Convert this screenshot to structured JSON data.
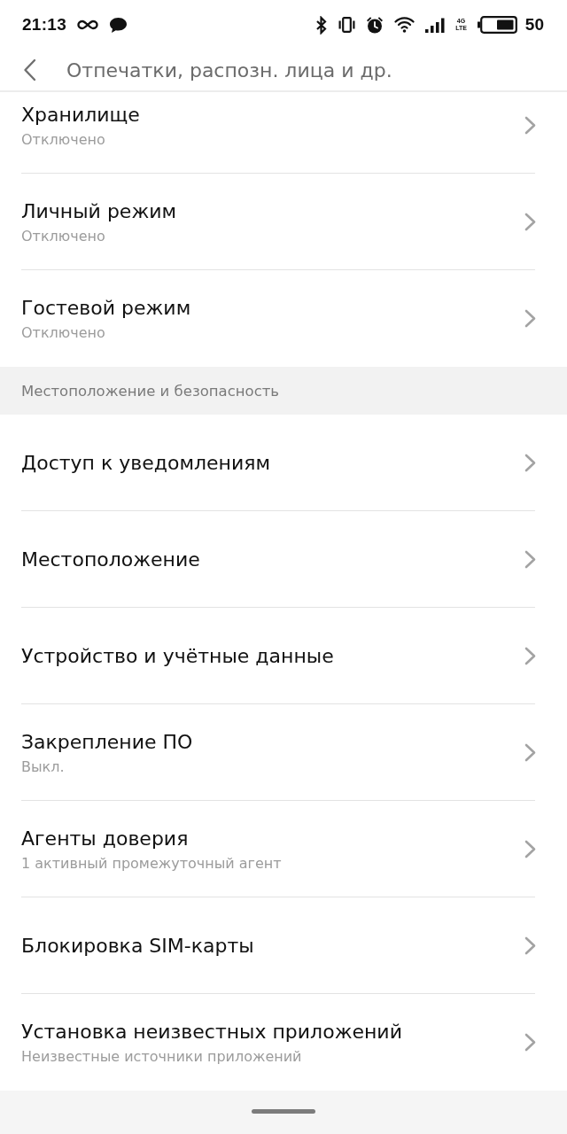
{
  "status_bar": {
    "time": "21:13",
    "network_type": [
      "4G",
      "LTE"
    ],
    "battery_percent": "50"
  },
  "header": {
    "title": "Отпечатки, распозн. лица и др."
  },
  "sections": [
    {
      "items": [
        {
          "title": "Хранилище",
          "subtitle": "Отключено"
        },
        {
          "title": "Личный режим",
          "subtitle": "Отключено"
        },
        {
          "title": "Гостевой режим",
          "subtitle": "Отключено"
        }
      ]
    },
    {
      "title": "Местоположение и безопасность",
      "items": [
        {
          "title": "Доступ к уведомлениям"
        },
        {
          "title": "Местоположение"
        },
        {
          "title": "Устройство и учётные данные"
        },
        {
          "title": "Закрепление ПО",
          "subtitle": "Выкл."
        },
        {
          "title": "Агенты доверия",
          "subtitle": "1 активный промежуточный агент"
        },
        {
          "title": "Блокировка SIM-карты"
        },
        {
          "title": "Установка неизвестных приложений",
          "subtitle": "Неизвестные источники приложений"
        }
      ]
    }
  ]
}
